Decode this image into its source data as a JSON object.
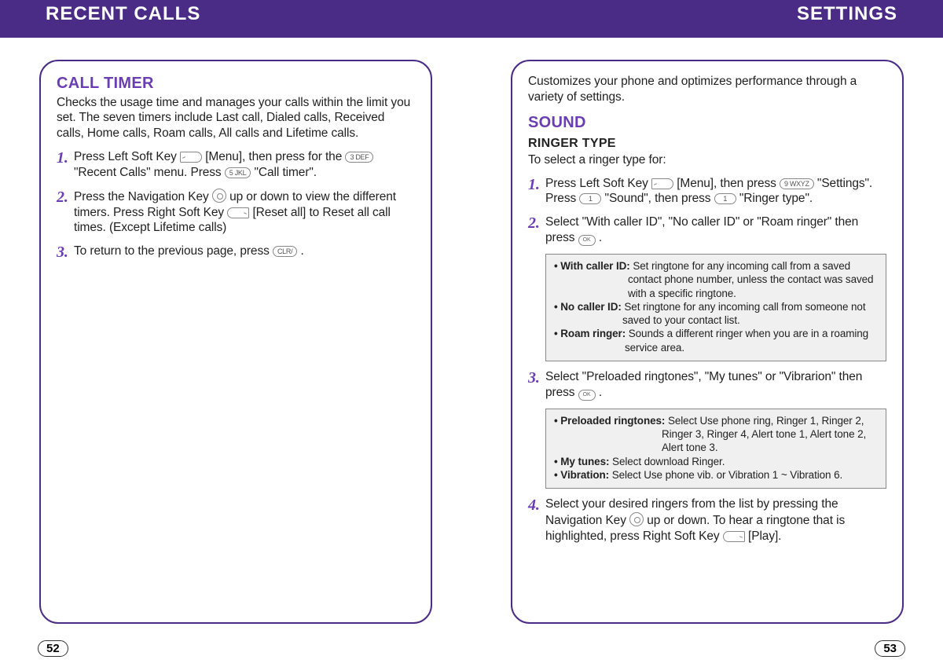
{
  "header": {
    "left": "RECENT CALLS",
    "right": "SETTINGS"
  },
  "left": {
    "title": "CALL TIMER",
    "intro": "Checks the usage time and manages your calls within the limit you set. The seven timers include Last call, Dialed calls, Received calls, Home calls, Roam calls, All calls and Lifetime calls.",
    "steps": {
      "s1a": "Press Left Soft Key ",
      "s1b": " [Menu], then press for the ",
      "s1c": " \"Recent Calls\" menu. Press ",
      "s1d": " \"Call timer\".",
      "s2a": "Press the Navigation Key ",
      "s2b": " up or down to view the different timers. Press Right Soft Key ",
      "s2c": " [Reset all] to Reset all call times. (Except Lifetime calls)",
      "s3a": "To return to the previous page, press ",
      "s3b": " ."
    },
    "keys": {
      "k3": "3 DEF",
      "k5": "5 JKL",
      "clr": "CLR/  "
    },
    "page": "52"
  },
  "right": {
    "intro": "Customizes your phone and optimizes performance through a variety of settings.",
    "title": "SOUND",
    "subtitle": "RINGER TYPE",
    "subintro": "To select a ringer type for:",
    "steps": {
      "s1a": "Press Left Soft Key ",
      "s1b": " [Menu], then press ",
      "s1c": " \"Settings\". Press ",
      "s1d": " \"Sound\", then press ",
      "s1e": " \"Ringer type\".",
      "s2a": "Select \"With caller ID\", \"No caller ID\" or \"Roam ringer\" then press ",
      "s2b": " .",
      "s3a": "Select \"Preloaded ringtones\", \"My tunes\" or \"Vibrarion\" then press ",
      "s3b": " .",
      "s4a": "Select your desired ringers from the list by pressing the Navigation Key ",
      "s4b": " up or down. To hear a ringtone that is highlighted, press Right Soft Key ",
      "s4c": " [Play]."
    },
    "keys": {
      "k9": "9 WXYZ",
      "k1a": "1",
      "k1b": "1"
    },
    "box1": {
      "b1label": "• With caller ID: ",
      "b1desc": "Set ringtone for any incoming call from a saved contact phone number, unless the contact was saved with a specific ringtone.",
      "b2label": "• No caller ID: ",
      "b2desc": "Set ringtone for any incoming call from someone not saved to your contact list.",
      "b3label": "• Roam ringer: ",
      "b3desc": "Sounds a different ringer when you are in a roaming service area."
    },
    "box2": {
      "b1label": "• Preloaded ringtones: ",
      "b1desc": "Select Use phone ring, Ringer 1, Ringer 2, Ringer 3, Ringer 4, Alert tone 1, Alert tone 2, Alert tone 3.",
      "b2label": "• My tunes: ",
      "b2desc": "Select download Ringer.",
      "b3label": "• Vibration: ",
      "b3desc": "Select Use phone vib. or Vibration 1 ~ Vibration 6."
    },
    "page": "53"
  },
  "ok": "OK"
}
